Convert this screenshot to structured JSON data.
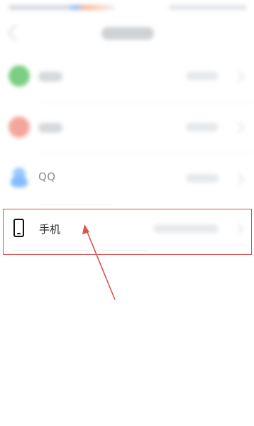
{
  "accounts": {
    "qq_label": "QQ",
    "phone_label": "手机"
  },
  "colors": {
    "highlight": "#d9534f",
    "annotation_arrow": "#d9534f",
    "wechat": "#4fbe5a",
    "weibo": "#f08a7a",
    "qq": "#5aa6ff"
  },
  "icons": {
    "back": "back-chevron-icon",
    "wechat": "wechat-icon",
    "weibo": "weibo-icon",
    "qq": "qq-icon",
    "phone": "phone-icon",
    "chevron": "chevron-right-icon"
  }
}
